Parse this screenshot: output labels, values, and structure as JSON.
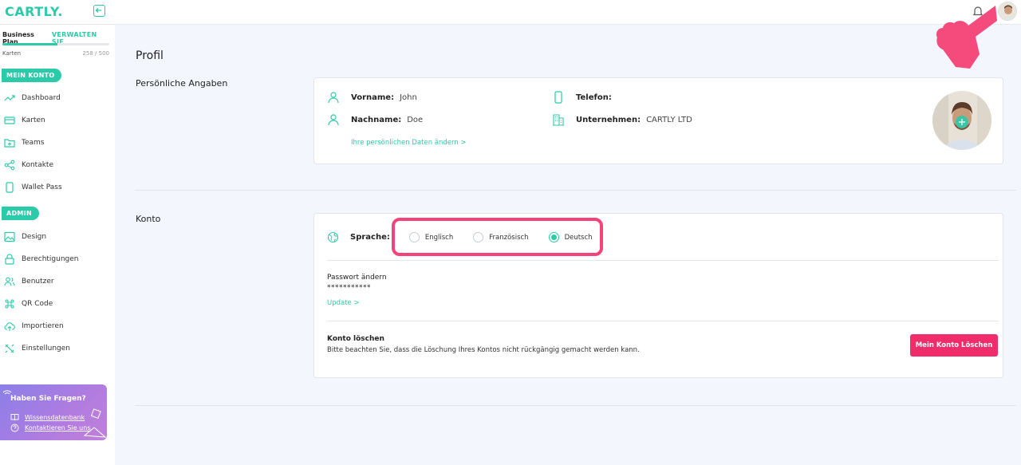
{
  "app": {
    "logo_text": "CARTLY."
  },
  "sidebar": {
    "plan_name": "Business Plan",
    "plan_manage": "VERWALTEN SIE",
    "plan_resource": "Karten",
    "plan_count": "258 / 500",
    "plan_progress_fraction": 0.516,
    "section_my_account": "MEIN KONTO",
    "my_account_items": [
      {
        "label": "Dashboard",
        "icon": "trend-icon"
      },
      {
        "label": "Karten",
        "icon": "card-icon"
      },
      {
        "label": "Teams",
        "icon": "folder-plus-icon"
      },
      {
        "label": "Kontakte",
        "icon": "share-icon"
      },
      {
        "label": "Wallet Pass",
        "icon": "phone-icon"
      }
    ],
    "section_admin": "ADMIN",
    "admin_items": [
      {
        "label": "Design",
        "icon": "image-icon"
      },
      {
        "label": "Berechtigungen",
        "icon": "lock-icon"
      },
      {
        "label": "Benutzer",
        "icon": "users-icon"
      },
      {
        "label": "QR Code",
        "icon": "command-icon"
      },
      {
        "label": "Importieren",
        "icon": "upload-cloud-icon"
      },
      {
        "label": "Einstellungen",
        "icon": "tools-icon"
      }
    ],
    "help": {
      "title": "Haben Sie Fragen?",
      "knowledge_base": "Wissensdatenbank",
      "contact": "Kontaktieren Sie uns"
    }
  },
  "main": {
    "page_title": "Profil",
    "personal": {
      "section_label": "Persönliche Angaben",
      "first_name_label": "Vorname:",
      "first_name_value": "John",
      "last_name_label": "Nachname:",
      "last_name_value": "Doe",
      "phone_label": "Telefon:",
      "phone_value": "",
      "company_label": "Unternehmen:",
      "company_value": "CARTLY LTD",
      "edit_link": "Ihre persönlichen Daten ändern >"
    },
    "account": {
      "section_label": "Konto",
      "language_label": "Sprache:",
      "languages": [
        "Englisch",
        "Französisch",
        "Deutsch"
      ],
      "selected_language": "Deutsch",
      "password_title": "Passwort ändern",
      "password_value": "***********",
      "password_update_link": "Update >",
      "delete_title": "Konto löschen",
      "delete_text": "Bitte beachten Sie, dass die Löschung Ihres Kontos nicht rückgängig gemacht werden kann.",
      "delete_button": "Mein Konto Löschen"
    }
  },
  "colors": {
    "accent": "#2bcaa8",
    "danger": "#f02c6a",
    "highlight": "#f4427a",
    "help_card": "#9b7fe6",
    "background": "#f3f6fc"
  }
}
